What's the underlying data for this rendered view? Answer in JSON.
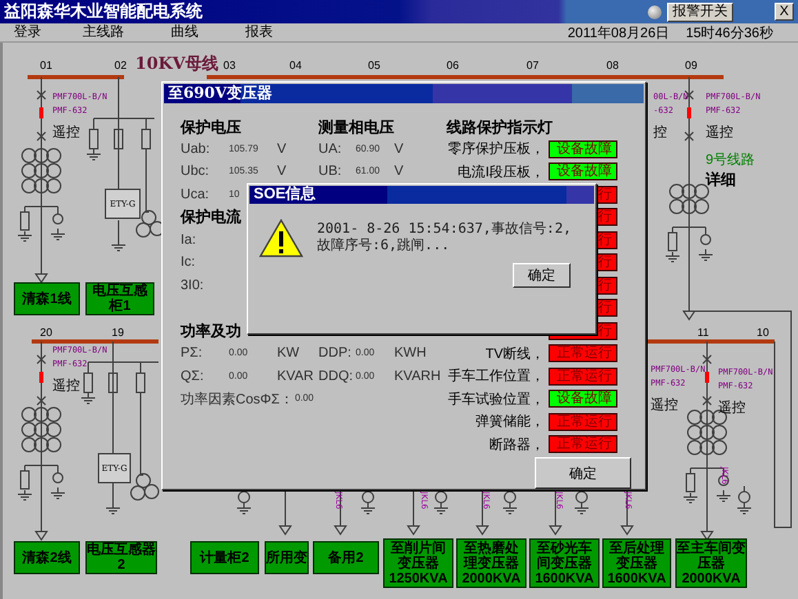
{
  "window": {
    "title": "益阳森华木业智能配电系统",
    "alarm_button": "报警开关",
    "close_button": "X"
  },
  "menu": [
    {
      "label": "登录"
    },
    {
      "label": "主线路"
    },
    {
      "label": "曲线"
    },
    {
      "label": "报表"
    }
  ],
  "date": "2011年08月26日",
  "time": "15时46分36秒",
  "diagram": {
    "bus_title": "10KV母线",
    "top_bay_numbers": [
      "01",
      "02",
      "03",
      "04",
      "05",
      "06",
      "07",
      "08",
      "09"
    ],
    "lower_bay_numbers": [
      "20",
      "19",
      "11",
      "10"
    ],
    "device_labels": [
      {
        "model": "PMF700L-B/N",
        "submodel": "PMF-632",
        "control": "遥控"
      },
      {
        "model": "00L-B/N",
        "submodel": "-632",
        "control": "控"
      },
      {
        "model": "PMF700L-B/N",
        "submodel": "PMF-632",
        "control": "遥控"
      },
      {
        "model": "PMF700L-B/N",
        "submodel": "PMF-632",
        "control": "遥控"
      },
      {
        "model": "PMF700L-B/N",
        "submodel": "PMF-632",
        "control": "遥控"
      },
      {
        "model": "PMF700L-B/N",
        "submodel": "PMF-632",
        "control": "遥控"
      }
    ],
    "line_name": "9号线路",
    "detail_link": "详细",
    "ety_labels": [
      "ETY-G",
      "ETY-G"
    ],
    "ct_labels": [
      "JKL6",
      "JKL6",
      "JKL6",
      "JKL6",
      "JKL6",
      "JKL6"
    ],
    "feeder_boxes": [
      {
        "label": "清森1线"
      },
      {
        "label": "电压互感柜1"
      },
      {
        "label": "清森2线"
      },
      {
        "label": "电压互感器2"
      },
      {
        "label": "计量柜2"
      },
      {
        "label": "所用变"
      },
      {
        "label": "备用2"
      },
      {
        "label": "至削片间变压器1250KVA"
      },
      {
        "label": "至热磨处理变压器2000KVA"
      },
      {
        "label": "至砂光车间变压器1600KVA"
      },
      {
        "label": "至后处理变压器1600KVA"
      },
      {
        "label": "至主车间变压器2000KVA"
      }
    ]
  },
  "dialog": {
    "title": "至690V变压器",
    "voltage_heading": "保护电压",
    "voltages": [
      {
        "label": "Uab:",
        "value": "105.79",
        "unit": "V"
      },
      {
        "label": "Ubc:",
        "value": "105.35",
        "unit": "V"
      },
      {
        "label": "Uca:",
        "value": "10"
      }
    ],
    "current_heading": "保护电流",
    "currents": [
      {
        "label": "Ia:"
      },
      {
        "label": "Ic:"
      },
      {
        "label": "3I0:"
      }
    ],
    "phase_heading": "测量相电压",
    "phase_voltages": [
      {
        "label": "UA:",
        "value": "60.90",
        "unit": "V"
      },
      {
        "label": "UB:",
        "value": "61.00",
        "unit": "V"
      }
    ],
    "power_heading": "功率及功",
    "power": [
      {
        "label": "PΣ:",
        "value": "0.00",
        "unit": "KW"
      },
      {
        "label": "QΣ:",
        "value": "0.00",
        "unit": "KVAR"
      }
    ],
    "energy": [
      {
        "label": "DDP:",
        "value": "0.00",
        "unit": "KWH"
      },
      {
        "label": "DDQ:",
        "value": "0.00",
        "unit": "KVARH"
      }
    ],
    "power_factor": {
      "label": "功率因素CosΦΣ：",
      "value": "0.00"
    },
    "indicator_heading": "线路保护指示灯",
    "indicators": [
      {
        "label": "零序保护压板，",
        "fault": true,
        "text": "设备故障"
      },
      {
        "label": "电流I段压板，",
        "fault": true,
        "text": "设备故障"
      },
      {
        "fault": false,
        "text": "行"
      },
      {
        "fault": false,
        "text": "行"
      },
      {
        "fault": false,
        "text": "行"
      },
      {
        "fault": false,
        "text": "行"
      },
      {
        "fault": false,
        "text": "行"
      },
      {
        "fault": false,
        "text": "行"
      },
      {
        "fault": false,
        "text": "行"
      },
      {
        "label": "TV断线，",
        "fault": false,
        "text": "正常运行"
      },
      {
        "label": "手车工作位置，",
        "fault": false,
        "text": "正常运行"
      },
      {
        "label": "手车试验位置，",
        "fault": true,
        "text": "设备故障"
      },
      {
        "label": "弹簧储能，",
        "fault": false,
        "text": "正常运行"
      },
      {
        "label": "断路器，",
        "fault": false,
        "text": "正常运行"
      }
    ],
    "ok_button": "确定"
  },
  "soe": {
    "title": "SOE信息",
    "message": "2001- 8-26 15:54:637,事故信号:2,故障序号:6,跳闸...",
    "ok_button": "确定"
  }
}
